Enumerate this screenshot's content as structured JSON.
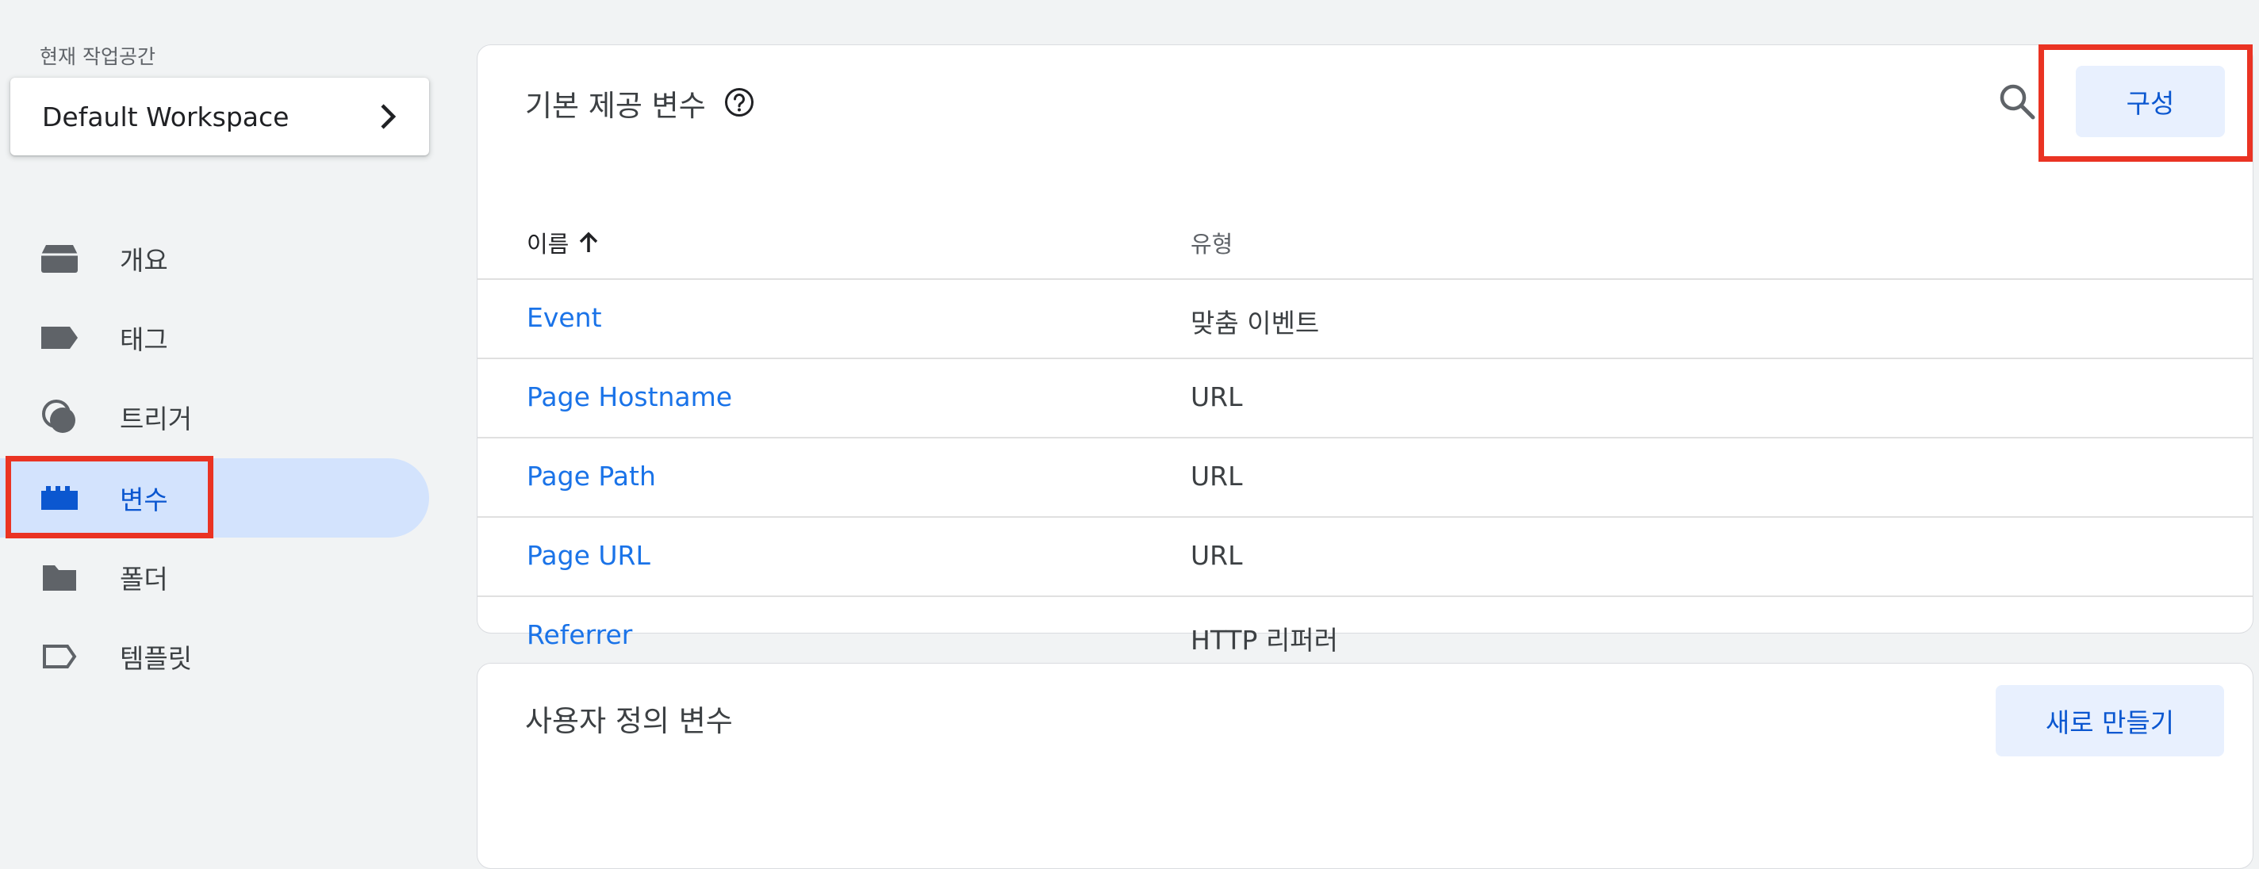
{
  "sidebar": {
    "workspace_label": "현재 작업공간",
    "workspace_name": "Default Workspace",
    "items": [
      {
        "label": "개요",
        "icon": "overview-icon"
      },
      {
        "label": "태그",
        "icon": "tag-icon"
      },
      {
        "label": "트리거",
        "icon": "trigger-icon"
      },
      {
        "label": "변수",
        "icon": "variable-icon",
        "active": true
      },
      {
        "label": "폴더",
        "icon": "folder-icon"
      },
      {
        "label": "템플릿",
        "icon": "template-icon"
      }
    ]
  },
  "builtin": {
    "title": "기본 제공 변수",
    "configure_label": "구성",
    "columns": {
      "name": "이름",
      "type": "유형"
    },
    "rows": [
      {
        "name": "Event",
        "type": "맞춤 이벤트"
      },
      {
        "name": "Page Hostname",
        "type": "URL"
      },
      {
        "name": "Page Path",
        "type": "URL"
      },
      {
        "name": "Page URL",
        "type": "URL"
      },
      {
        "name": "Referrer",
        "type": "HTTP 리퍼러"
      }
    ]
  },
  "user_defined": {
    "title": "사용자 정의 변수",
    "new_label": "새로 만들기"
  },
  "colors": {
    "accent": "#0b57d0",
    "link": "#1a73e8",
    "active_bg": "#d3e3fd",
    "highlight": "#ea3323"
  }
}
